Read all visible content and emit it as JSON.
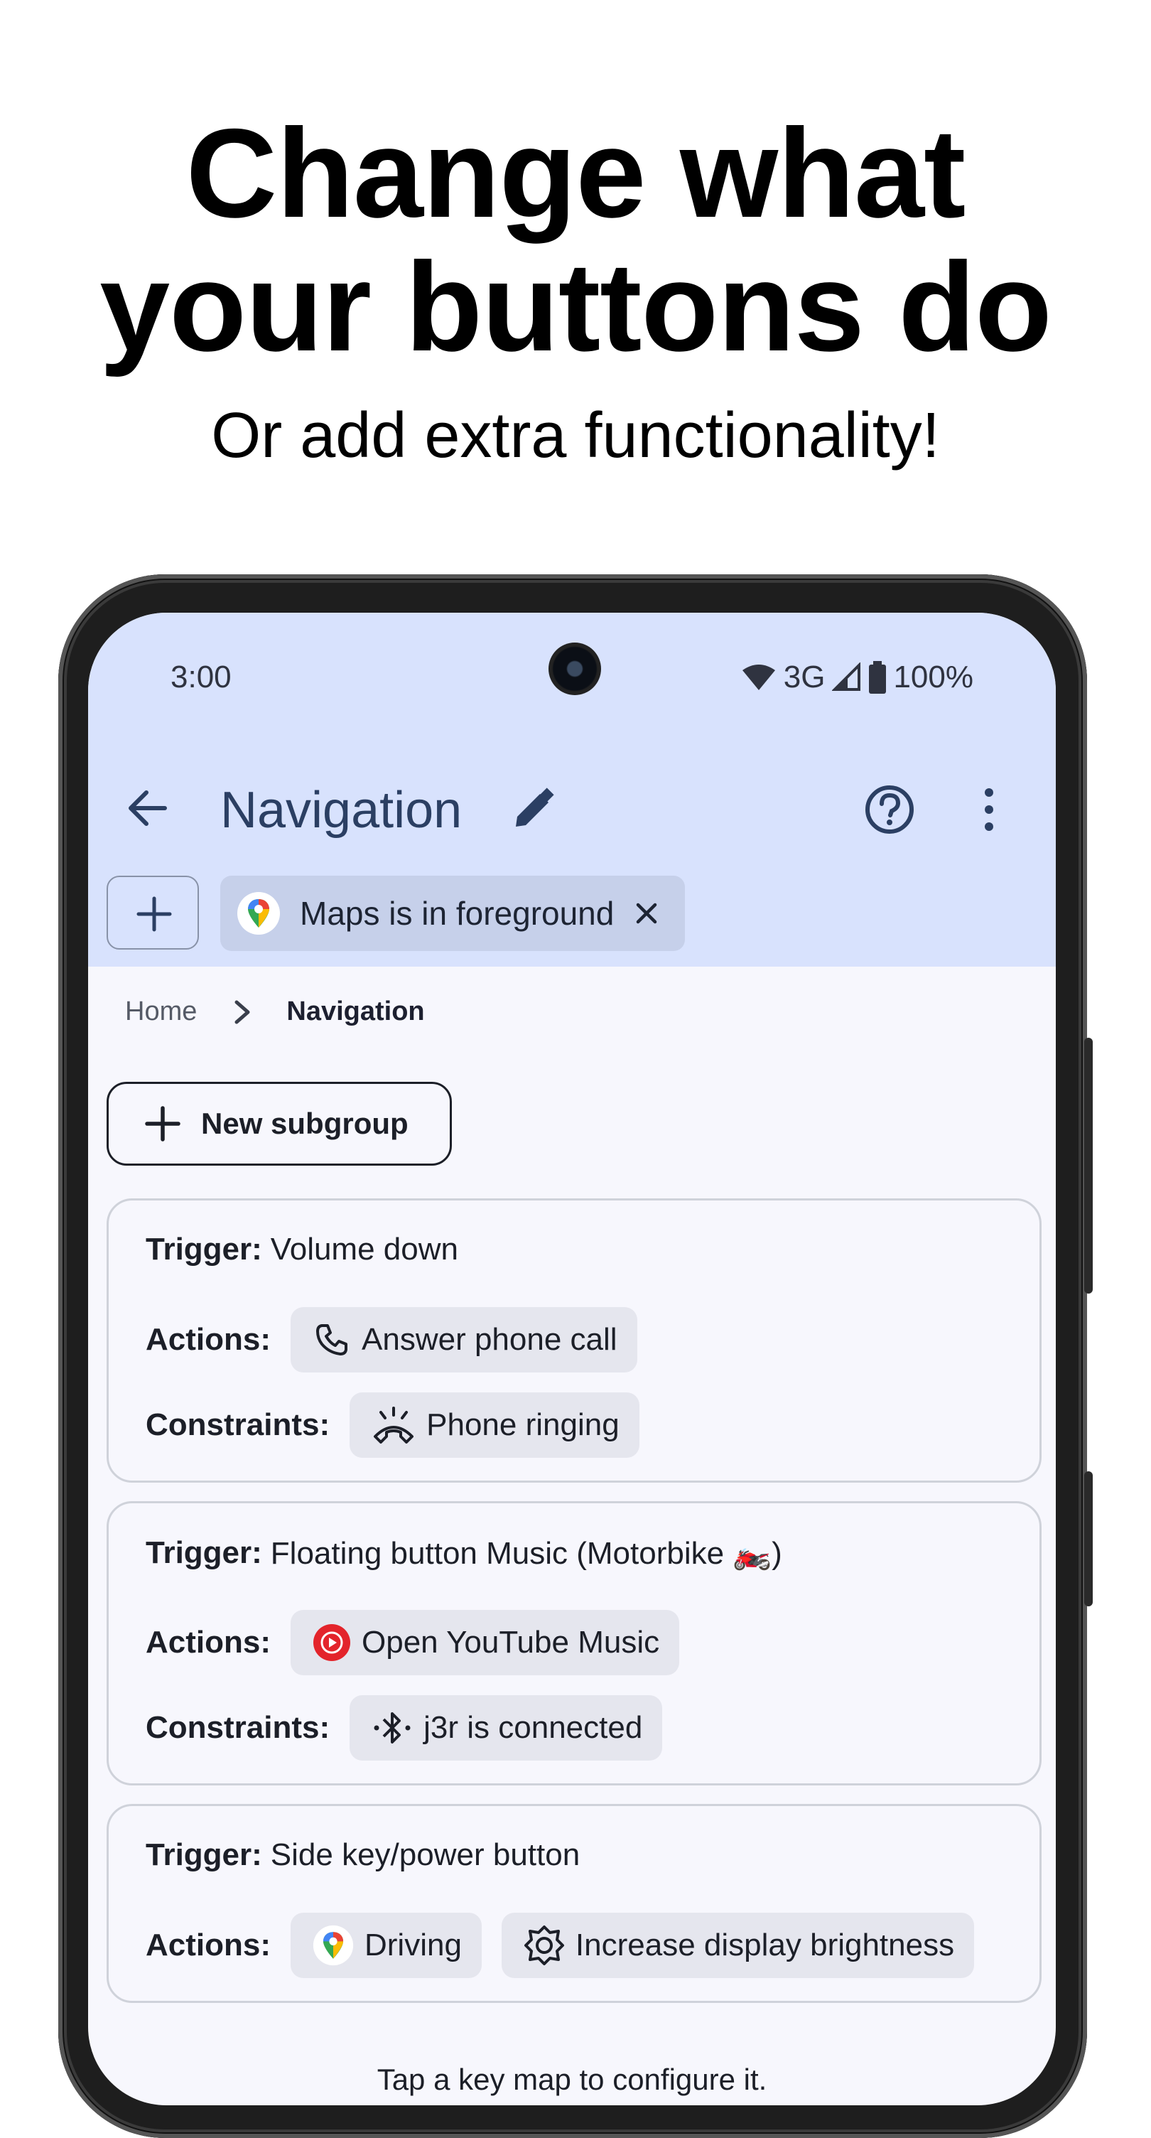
{
  "headline": {
    "line1": "Change what",
    "line2": "your buttons do"
  },
  "subheadline": "Or add extra functionality!",
  "status_bar": {
    "time": "3:00",
    "network": "3G",
    "battery": "100%"
  },
  "app_bar": {
    "title": "Navigation"
  },
  "foreground_chip": {
    "label": "Maps is in foreground"
  },
  "breadcrumb": {
    "home": "Home",
    "current": "Navigation"
  },
  "new_subgroup_label": "New subgroup",
  "key_maps": [
    {
      "trigger_label": "Trigger:",
      "trigger_value": "Volume down",
      "actions_label": "Actions:",
      "actions": [
        "Answer phone call"
      ],
      "constraints_label": "Constraints:",
      "constraints": [
        "Phone ringing"
      ]
    },
    {
      "trigger_label": "Trigger:",
      "trigger_value": "Floating button Music (Motorbike 🏍️)",
      "actions_label": "Actions:",
      "actions": [
        "Open YouTube Music"
      ],
      "constraints_label": "Constraints:",
      "constraints": [
        "j3r is connected"
      ]
    },
    {
      "trigger_label": "Trigger:",
      "trigger_value": "Side key/power button",
      "actions_label": "Actions:",
      "actions": [
        "Driving",
        "Increase display brightness"
      ]
    }
  ],
  "footer_hint": "Tap a key map to configure it.",
  "colors": {
    "top_bar": "#d8e2fd",
    "title": "#2b3f63",
    "surface": "#f7f7fd",
    "chip": "#e5e6ee",
    "youtube_music": "#e3242b"
  }
}
